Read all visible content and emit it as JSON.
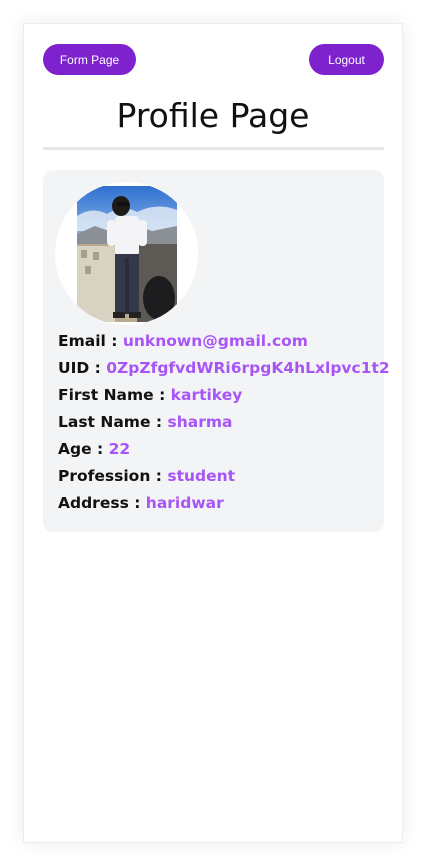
{
  "header": {
    "form_button": "Form Page",
    "logout_button": "Logout",
    "title": "Profile Page"
  },
  "profile": {
    "email": {
      "label": "Email : ",
      "value": "unknown@gmail.com"
    },
    "uid": {
      "label": "UID : ",
      "value": "0ZpZfgfvdWRi6rpgK4hLxlpvc1t2"
    },
    "first_name": {
      "label": "First Name : ",
      "value": "kartikey"
    },
    "last_name": {
      "label": "Last Name : ",
      "value": "sharma"
    },
    "age": {
      "label": "Age : ",
      "value": "22"
    },
    "profession": {
      "label": "Profession : ",
      "value": "student"
    },
    "address": {
      "label": "Address : ",
      "value": "haridwar"
    }
  },
  "colors": {
    "button": "#7e22ce",
    "value_text": "#a855f7",
    "card_bg": "#f3f4f6"
  }
}
